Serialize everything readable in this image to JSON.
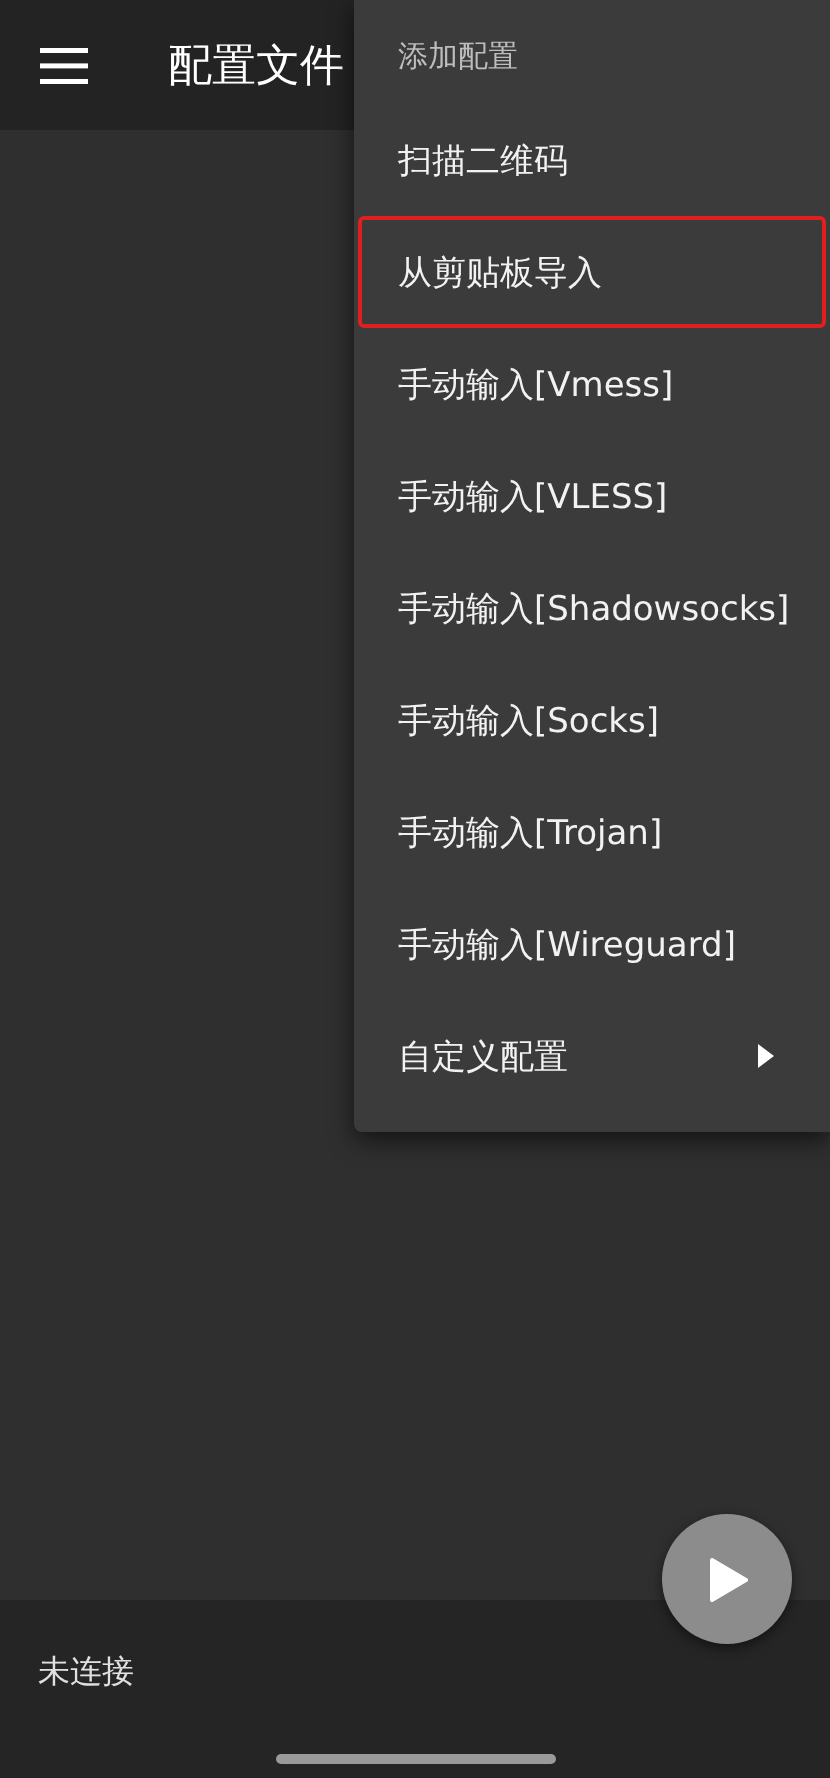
{
  "app_bar": {
    "title": "配置文件"
  },
  "menu": {
    "items": [
      {
        "kind": "header",
        "label": "添加配置",
        "highlighted": false
      },
      {
        "kind": "item",
        "label": "扫描二维码",
        "highlighted": false
      },
      {
        "kind": "item",
        "label": "从剪贴板导入",
        "highlighted": true
      },
      {
        "kind": "item",
        "label": "手动输入[Vmess]",
        "highlighted": false
      },
      {
        "kind": "item",
        "label": "手动输入[VLESS]",
        "highlighted": false
      },
      {
        "kind": "item",
        "label": "手动输入[Shadowsocks]",
        "highlighted": false
      },
      {
        "kind": "item",
        "label": "手动输入[Socks]",
        "highlighted": false
      },
      {
        "kind": "item",
        "label": "手动输入[Trojan]",
        "highlighted": false
      },
      {
        "kind": "item",
        "label": "手动输入[Wireguard]",
        "highlighted": false
      },
      {
        "kind": "submenu",
        "label": "自定义配置",
        "highlighted": false
      }
    ]
  },
  "status_bar": {
    "text": "未连接"
  }
}
